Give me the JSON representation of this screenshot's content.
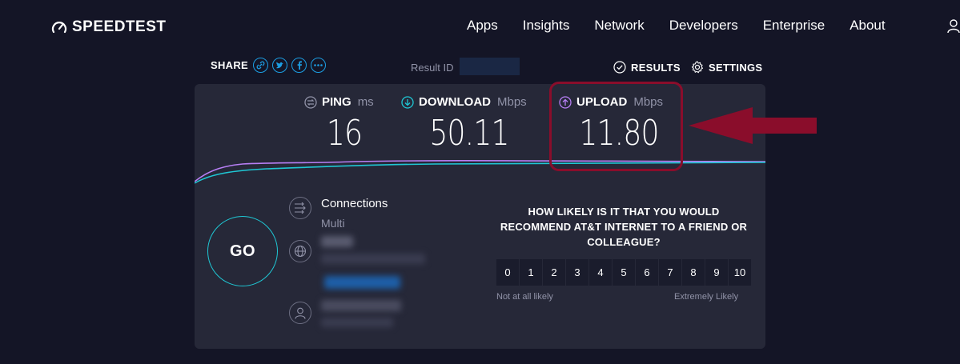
{
  "header": {
    "logo_text": "SPEEDTEST",
    "nav": [
      "Apps",
      "Insights",
      "Network",
      "Developers",
      "Enterprise",
      "About"
    ]
  },
  "share": {
    "label": "SHARE",
    "buttons": [
      "link-icon",
      "twitter-icon",
      "facebook-icon",
      "more-icon"
    ]
  },
  "result": {
    "id_label": "Result ID"
  },
  "actions": {
    "results_label": "RESULTS",
    "settings_label": "SETTINGS"
  },
  "metrics": {
    "ping": {
      "label": "PING",
      "unit": "ms",
      "value": "16"
    },
    "download": {
      "label": "DOWNLOAD",
      "unit": "Mbps",
      "value": "50.11"
    },
    "upload": {
      "label": "UPLOAD",
      "unit": "Mbps",
      "value": "11.80"
    }
  },
  "go": {
    "label": "GO"
  },
  "connections": {
    "label": "Connections",
    "value": "Multi"
  },
  "survey": {
    "question": "HOW LIKELY IS IT THAT YOU WOULD RECOMMEND AT&T INTERNET TO A FRIEND OR COLLEAGUE?",
    "scale": [
      "0",
      "1",
      "2",
      "3",
      "4",
      "5",
      "6",
      "7",
      "8",
      "9",
      "10"
    ],
    "low_label": "Not at all likely",
    "high_label": "Extremely Likely"
  },
  "colors": {
    "background": "#141526",
    "panel": "#262838",
    "download_accent": "#1fc7d4",
    "upload_accent": "#b77ff5",
    "share_accent": "#1c9ee3",
    "annotation": "#8a0d2b"
  }
}
